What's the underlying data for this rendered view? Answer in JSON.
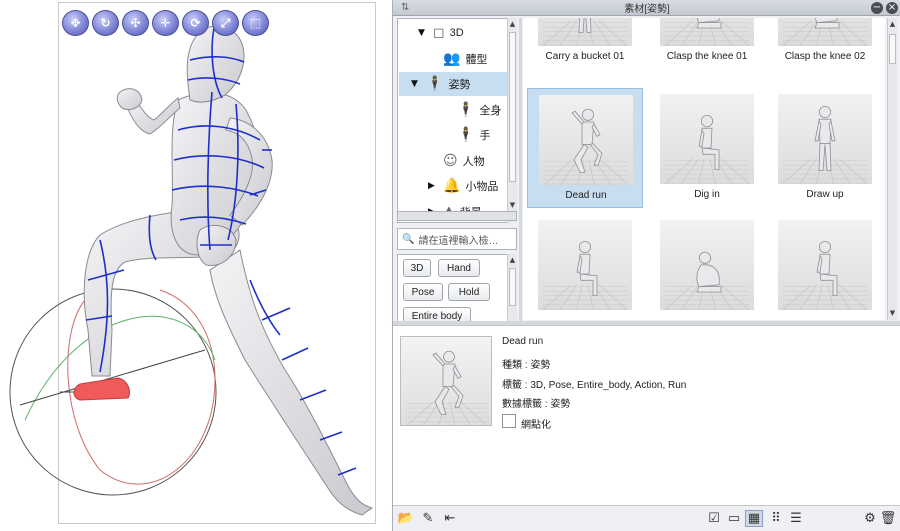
{
  "window": {
    "title": "素材[姿勢]",
    "grip": "⇅",
    "minimize_glyph": "−",
    "close_glyph": "×"
  },
  "manipulator_icons": [
    "move-camera-icon",
    "rotate-camera-icon",
    "pan-camera-icon",
    "move-object-icon",
    "rotate-object-icon",
    "scale-object-icon",
    "pose-icon"
  ],
  "tree": {
    "items": [
      {
        "label": "3D",
        "level": 0,
        "expand": "▼",
        "icon": "cube-icon",
        "glyph": "◻"
      },
      {
        "label": "體型",
        "level": 1,
        "expand": "",
        "icon": "body-type-icon",
        "glyph": "👥"
      },
      {
        "label": "姿勢",
        "level": 1,
        "expand": "▼",
        "icon": "pose-figure-icon",
        "glyph": "🕴",
        "selected": true
      },
      {
        "label": "全身",
        "level": 2,
        "expand": "",
        "icon": "full-body-icon",
        "glyph": "🕴"
      },
      {
        "label": "手",
        "level": 2,
        "expand": "",
        "icon": "hand-figure-icon",
        "glyph": "🕴"
      },
      {
        "label": "人物",
        "level": 1,
        "expand": "",
        "icon": "character-icon",
        "glyph": "☺"
      },
      {
        "label": "小物品",
        "level": 1,
        "expand": "▶",
        "icon": "small-object-icon",
        "glyph": "🔔"
      },
      {
        "label": "背景",
        "level": 1,
        "expand": "▶",
        "icon": "background-icon",
        "glyph": "⛰"
      }
    ]
  },
  "search": {
    "icon_glyph": "🔍",
    "placeholder": "請在這裡輸入檢…"
  },
  "tags": [
    {
      "label": "3D"
    },
    {
      "label": "Hand"
    },
    {
      "label": "Pose"
    },
    {
      "label": "Hold"
    },
    {
      "label": "Entire body"
    }
  ],
  "materials": [
    {
      "label": "Carry a bucket 01",
      "pose": "stand"
    },
    {
      "label": "Clasp the knee 01",
      "pose": "crouch"
    },
    {
      "label": "Clasp the knee 02",
      "pose": "crouch"
    },
    {
      "label": "Dead run",
      "pose": "run",
      "selected": true
    },
    {
      "label": "Dig in",
      "pose": "sit"
    },
    {
      "label": "Draw up",
      "pose": "stand"
    },
    {
      "label": "",
      "pose": "sit"
    },
    {
      "label": "",
      "pose": "crouch"
    },
    {
      "label": "",
      "pose": "sit"
    }
  ],
  "detail": {
    "name": "Dead run",
    "type_line": "種類 : 姿勢",
    "tag_line": "標籤 : 3D, Pose, Entire_body, Action, Run",
    "category_line": "數據標籤 : 姿勢",
    "binarize_label": "網點化",
    "binarize_checked": false
  },
  "bottom_toolbar": {
    "left": [
      {
        "name": "open-folder-icon",
        "glyph": "📂"
      },
      {
        "name": "paste-to-canvas-icon",
        "glyph": "✎"
      },
      {
        "name": "remove-icon",
        "glyph": "⇤"
      }
    ],
    "right": [
      {
        "name": "checkbox-view-icon",
        "glyph": "☑"
      },
      {
        "name": "detail-view-icon",
        "glyph": "▭"
      },
      {
        "name": "large-thumbnail-view-icon",
        "glyph": "▦",
        "active": true
      },
      {
        "name": "small-thumbnail-view-icon",
        "glyph": "⠿"
      },
      {
        "name": "list-view-icon",
        "glyph": "☰"
      },
      {
        "name": "material-property-icon",
        "glyph": "⚙"
      },
      {
        "name": "delete-icon",
        "glyph": "🗑"
      }
    ]
  },
  "colors": {
    "selection": "#c7ddf0",
    "wireframe": "#1f2fc8",
    "handle": "#f05a5a",
    "panel_bg": "#eef0f3"
  }
}
